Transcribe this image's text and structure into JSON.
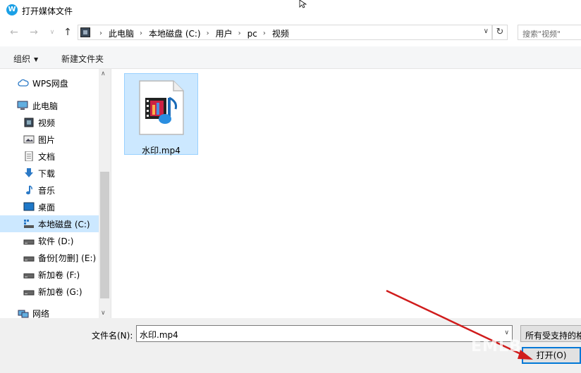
{
  "window": {
    "title": "打开媒体文件",
    "icon": "wps-logo-icon"
  },
  "nav": {
    "breadcrumbs": [
      "此电脑",
      "本地磁盘 (C:)",
      "用户",
      "pc",
      "视频"
    ],
    "search_placeholder": "搜索\"视频\""
  },
  "toolbar": {
    "organize_label": "组织",
    "new_folder_label": "新建文件夹"
  },
  "sidebar": {
    "items": [
      {
        "label": "WPS网盘",
        "icon": "cloud-icon"
      },
      {
        "label": "此电脑",
        "icon": "computer-icon"
      },
      {
        "label": "视频",
        "icon": "video-folder-icon"
      },
      {
        "label": "图片",
        "icon": "pictures-folder-icon"
      },
      {
        "label": "文档",
        "icon": "documents-folder-icon"
      },
      {
        "label": "下载",
        "icon": "download-icon"
      },
      {
        "label": "音乐",
        "icon": "music-icon"
      },
      {
        "label": "桌面",
        "icon": "desktop-icon"
      },
      {
        "label": "本地磁盘 (C:)",
        "icon": "system-drive-icon",
        "selected": true
      },
      {
        "label": "软件 (D:)",
        "icon": "drive-icon"
      },
      {
        "label": "备份[勿删] (E:)",
        "icon": "drive-icon"
      },
      {
        "label": "新加卷 (F:)",
        "icon": "drive-icon"
      },
      {
        "label": "新加卷 (G:)",
        "icon": "drive-icon"
      },
      {
        "label": "网络",
        "icon": "network-icon"
      }
    ]
  },
  "files": [
    {
      "name": "水印.mp4",
      "icon": "media-file-icon",
      "selected": true
    }
  ],
  "footer": {
    "filename_label": "文件名(N):",
    "filename_value": "水印.mp4",
    "filter_label": "所有受支持的格",
    "open_label": "打开(O)"
  },
  "colors": {
    "selection": "#cce8ff",
    "accent": "#0078d7",
    "arrow": "#d01c1c"
  },
  "watermark": "EMLB"
}
